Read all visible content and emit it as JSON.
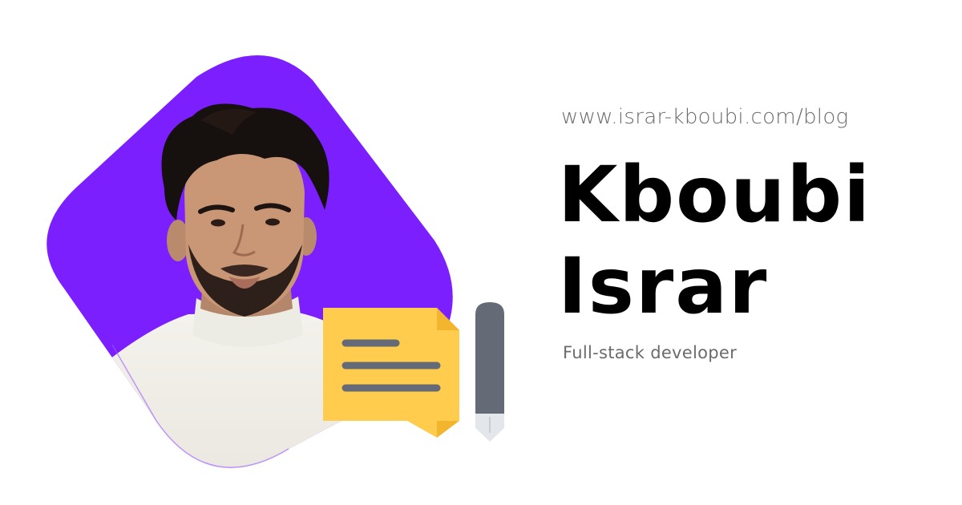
{
  "profile": {
    "url": "www.israr-kboubi.com/blog",
    "first_line": "Kboubi",
    "second_line": "Israr",
    "role": "Full-stack developer"
  },
  "images": {
    "portrait": "person-portrait",
    "chat": "chat-bubble-icon",
    "pen": "pen-icon"
  },
  "colors": {
    "accent": "#7B1FFF",
    "note": "#FFCC4D",
    "pen": "#656B76"
  }
}
